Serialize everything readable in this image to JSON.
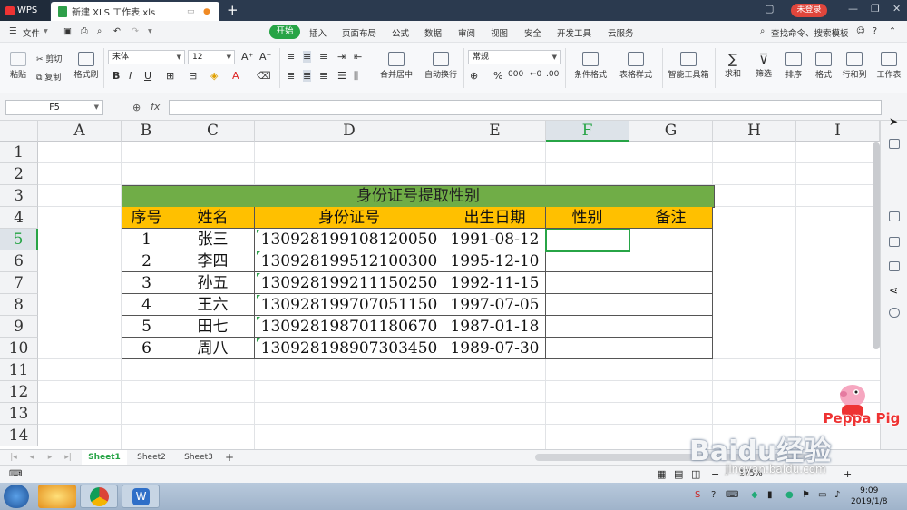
{
  "titlebar": {
    "app": "WPS",
    "doc_title": "新建 XLS 工作表.xls",
    "new_tab": "+",
    "login": "未登录"
  },
  "menu": {
    "file": "文件",
    "tabs": [
      "开始",
      "插入",
      "页面布局",
      "公式",
      "数据",
      "审阅",
      "视图",
      "安全",
      "开发工具",
      "云服务"
    ],
    "search": "查找命令、搜索模板"
  },
  "ribbon": {
    "paste": "粘贴",
    "cut": "剪切",
    "copy": "复制",
    "format_painter": "格式刷",
    "font": "宋体",
    "size": "12",
    "merge": "合并居中",
    "wrap": "自动换行",
    "number_format": "常规",
    "cond_format": "条件格式",
    "table_style": "表格样式",
    "smart_tools": "智能工具箱",
    "sum": "求和",
    "filter": "筛选",
    "sort": "排序",
    "format": "格式",
    "row_col": "行和列",
    "worksheet": "工作表"
  },
  "formula_bar": {
    "cell_ref": "F5",
    "fx": "fx",
    "formula": ""
  },
  "grid": {
    "columns": [
      "A",
      "B",
      "C",
      "D",
      "E",
      "F",
      "G",
      "H",
      "I"
    ],
    "rows": [
      "1",
      "2",
      "3",
      "4",
      "5",
      "6",
      "7",
      "8",
      "9",
      "10",
      "11",
      "12",
      "13",
      "14"
    ],
    "selected": "F5"
  },
  "table": {
    "title": "身份证号提取性别",
    "headers": [
      "序号",
      "姓名",
      "身份证号",
      "出生日期",
      "性别",
      "备注"
    ],
    "rows": [
      [
        "1",
        "张三",
        "130928199108120050",
        "1991-08-12",
        "",
        ""
      ],
      [
        "2",
        "李四",
        "130928199512100300",
        "1995-12-10",
        "",
        ""
      ],
      [
        "3",
        "孙五",
        "130928199211150250",
        "1992-11-15",
        "",
        ""
      ],
      [
        "4",
        "王六",
        "130928199707051150",
        "1997-07-05",
        "",
        ""
      ],
      [
        "5",
        "田七",
        "130928198701180670",
        "1987-01-18",
        "",
        ""
      ],
      [
        "6",
        "周八",
        "130928198907303450",
        "1989-07-30",
        "",
        ""
      ]
    ]
  },
  "sheets": {
    "tabs": [
      "Sheet1",
      "Sheet2",
      "Sheet3"
    ],
    "add": "+"
  },
  "status": {
    "zoom": "175%"
  },
  "taskbar": {
    "time": "9:09",
    "date": "2019/1/8"
  },
  "watermark": {
    "baidu": "Baidu经验",
    "url": "jingyan.baidu.com",
    "peppa": "Peppa Pig"
  },
  "colors": {
    "accent": "#27a446",
    "title_fill": "#70ad47",
    "header_fill": "#ffc000"
  }
}
